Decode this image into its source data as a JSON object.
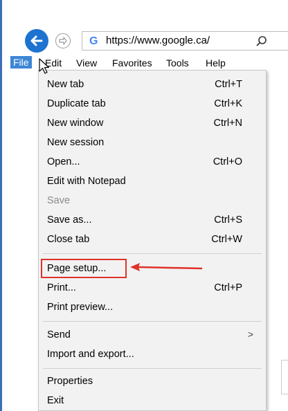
{
  "address_bar": {
    "url": "https://www.google.ca/"
  },
  "menubar": {
    "items": [
      "File",
      "Edit",
      "View",
      "Favorites",
      "Tools",
      "Help"
    ]
  },
  "file_menu": {
    "items": [
      {
        "label": "New tab",
        "shortcut": "Ctrl+T"
      },
      {
        "label": "Duplicate tab",
        "shortcut": "Ctrl+K"
      },
      {
        "label": "New window",
        "shortcut": "Ctrl+N"
      },
      {
        "label": "New session",
        "shortcut": ""
      },
      {
        "label": "Open...",
        "shortcut": "Ctrl+O"
      },
      {
        "label": "Edit with Notepad",
        "shortcut": ""
      },
      {
        "label": "Save",
        "shortcut": ""
      },
      {
        "label": "Save as...",
        "shortcut": "Ctrl+S"
      },
      {
        "label": "Close tab",
        "shortcut": "Ctrl+W"
      },
      {
        "label": "Page setup...",
        "shortcut": ""
      },
      {
        "label": "Print...",
        "shortcut": "Ctrl+P"
      },
      {
        "label": "Print preview...",
        "shortcut": ""
      },
      {
        "label": "Send",
        "shortcut": ""
      },
      {
        "label": "Import and export...",
        "shortcut": ""
      },
      {
        "label": "Properties",
        "shortcut": ""
      },
      {
        "label": "Exit",
        "shortcut": ""
      }
    ]
  },
  "colors": {
    "accent": "#1e73d0",
    "menu_highlight": "#3c86d6",
    "annotation_red": "#e0312a"
  },
  "icons": {
    "back": "back-arrow-icon",
    "forward": "forward-arrow-icon",
    "site": "google-g-icon",
    "search": "search-icon",
    "submenu": "chevron-right-icon",
    "cursor": "mouse-pointer-icon"
  }
}
